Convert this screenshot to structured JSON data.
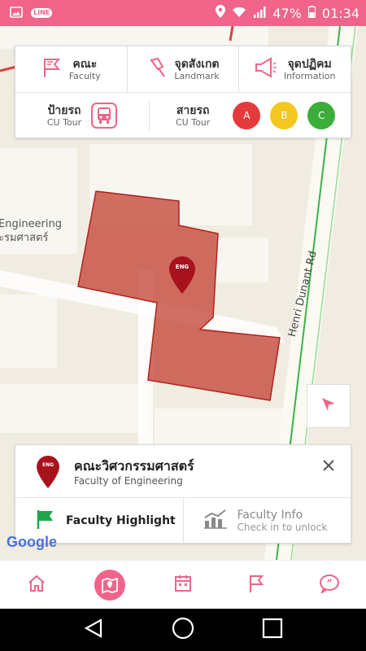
{
  "status_bar": {
    "app_badge": "LINE",
    "battery": "47%",
    "time": "01:34"
  },
  "top_panel": {
    "faculty": {
      "th": "คณะ",
      "en": "Faculty"
    },
    "landmark": {
      "th": "จุดสังเกต",
      "en": "Landmark"
    },
    "information": {
      "th": "จุดปฏิคม",
      "en": "Information"
    },
    "bus_stop": {
      "th": "ป้ายรถ",
      "en": "CU Tour"
    },
    "bus_line": {
      "th": "สายรถ",
      "en": "CU Tour"
    },
    "lines": [
      {
        "label": "A",
        "color": "#e33b3b"
      },
      {
        "label": "B",
        "color": "#f2c81f"
      },
      {
        "label": "C",
        "color": "#3aad3a"
      }
    ]
  },
  "map": {
    "label_eng_line1": "Engineering",
    "label_eng_line2": "ะรมศาสตร์",
    "road_label": "Henri Dunant Rd",
    "pin_text": "ENG"
  },
  "info_card": {
    "pin_text": "ENG",
    "title_th": "คณะวิศวกรรมศาสตร์",
    "title_en": "Faculty of Engineering",
    "highlight_label": "Faculty  Highlight",
    "info_label": "Faculty  Info",
    "info_sub": "Check in to unlock"
  },
  "google_logo": "Google",
  "colors": {
    "accent": "#f0648a",
    "polygon": "#c0392b"
  }
}
